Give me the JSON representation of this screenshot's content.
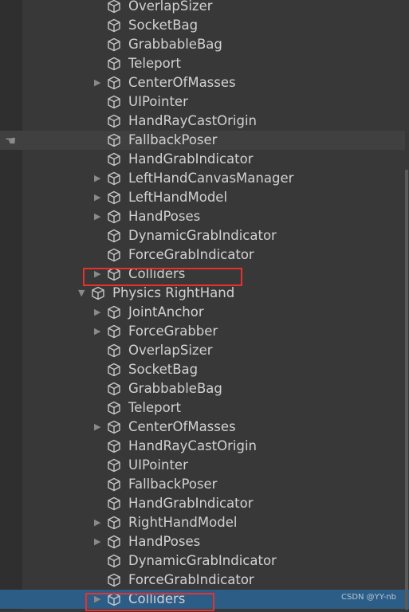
{
  "rows": [
    {
      "label": "OverlapSizer",
      "level": 2,
      "arrow": false
    },
    {
      "label": "SocketBag",
      "level": 2,
      "arrow": false
    },
    {
      "label": "GrabbableBag",
      "level": 2,
      "arrow": false
    },
    {
      "label": "Teleport",
      "level": 2,
      "arrow": false
    },
    {
      "label": "CenterOfMasses",
      "level": 2,
      "arrow": "collapsed"
    },
    {
      "label": "UIPointer",
      "level": 2,
      "arrow": false
    },
    {
      "label": "HandRayCastOrigin",
      "level": 2,
      "arrow": false
    },
    {
      "label": "FallbackPoser",
      "level": 2,
      "arrow": false,
      "state": "hover"
    },
    {
      "label": "HandGrabIndicator",
      "level": 2,
      "arrow": false
    },
    {
      "label": "LeftHandCanvasManager",
      "level": 2,
      "arrow": "collapsed"
    },
    {
      "label": "LeftHandModel",
      "level": 2,
      "arrow": "collapsed"
    },
    {
      "label": "HandPoses",
      "level": 2,
      "arrow": "collapsed"
    },
    {
      "label": "DynamicGrabIndicator",
      "level": 2,
      "arrow": false
    },
    {
      "label": "ForceGrabIndicator",
      "level": 2,
      "arrow": false
    },
    {
      "label": "Colliders",
      "level": 2,
      "arrow": "collapsed",
      "highlighted": true
    },
    {
      "label": "Physics RightHand",
      "level": 1,
      "arrow": "expanded"
    },
    {
      "label": "JointAnchor",
      "level": 2,
      "arrow": "collapsed"
    },
    {
      "label": "ForceGrabber",
      "level": 2,
      "arrow": "collapsed"
    },
    {
      "label": "OverlapSizer",
      "level": 2,
      "arrow": false
    },
    {
      "label": "SocketBag",
      "level": 2,
      "arrow": false
    },
    {
      "label": "GrabbableBag",
      "level": 2,
      "arrow": false
    },
    {
      "label": "Teleport",
      "level": 2,
      "arrow": false
    },
    {
      "label": "CenterOfMasses",
      "level": 2,
      "arrow": "collapsed"
    },
    {
      "label": "HandRayCastOrigin",
      "level": 2,
      "arrow": false
    },
    {
      "label": "UIPointer",
      "level": 2,
      "arrow": false
    },
    {
      "label": "FallbackPoser",
      "level": 2,
      "arrow": false
    },
    {
      "label": "HandGrabIndicator",
      "level": 2,
      "arrow": false
    },
    {
      "label": "RightHandModel",
      "level": 2,
      "arrow": "collapsed"
    },
    {
      "label": "HandPoses",
      "level": 2,
      "arrow": "collapsed"
    },
    {
      "label": "DynamicGrabIndicator",
      "level": 2,
      "arrow": false
    },
    {
      "label": "ForceGrabIndicator",
      "level": 2,
      "arrow": false
    },
    {
      "label": "Colliders",
      "level": 2,
      "arrow": "collapsed",
      "state": "selected",
      "highlighted": true
    }
  ],
  "icons": {
    "object": "cube-icon",
    "hover": "hand-pointer-icon"
  },
  "colors": {
    "selected": "#2c5d87",
    "highlight_box": "#e8312f"
  },
  "watermark": "CSDN @YY-nb"
}
